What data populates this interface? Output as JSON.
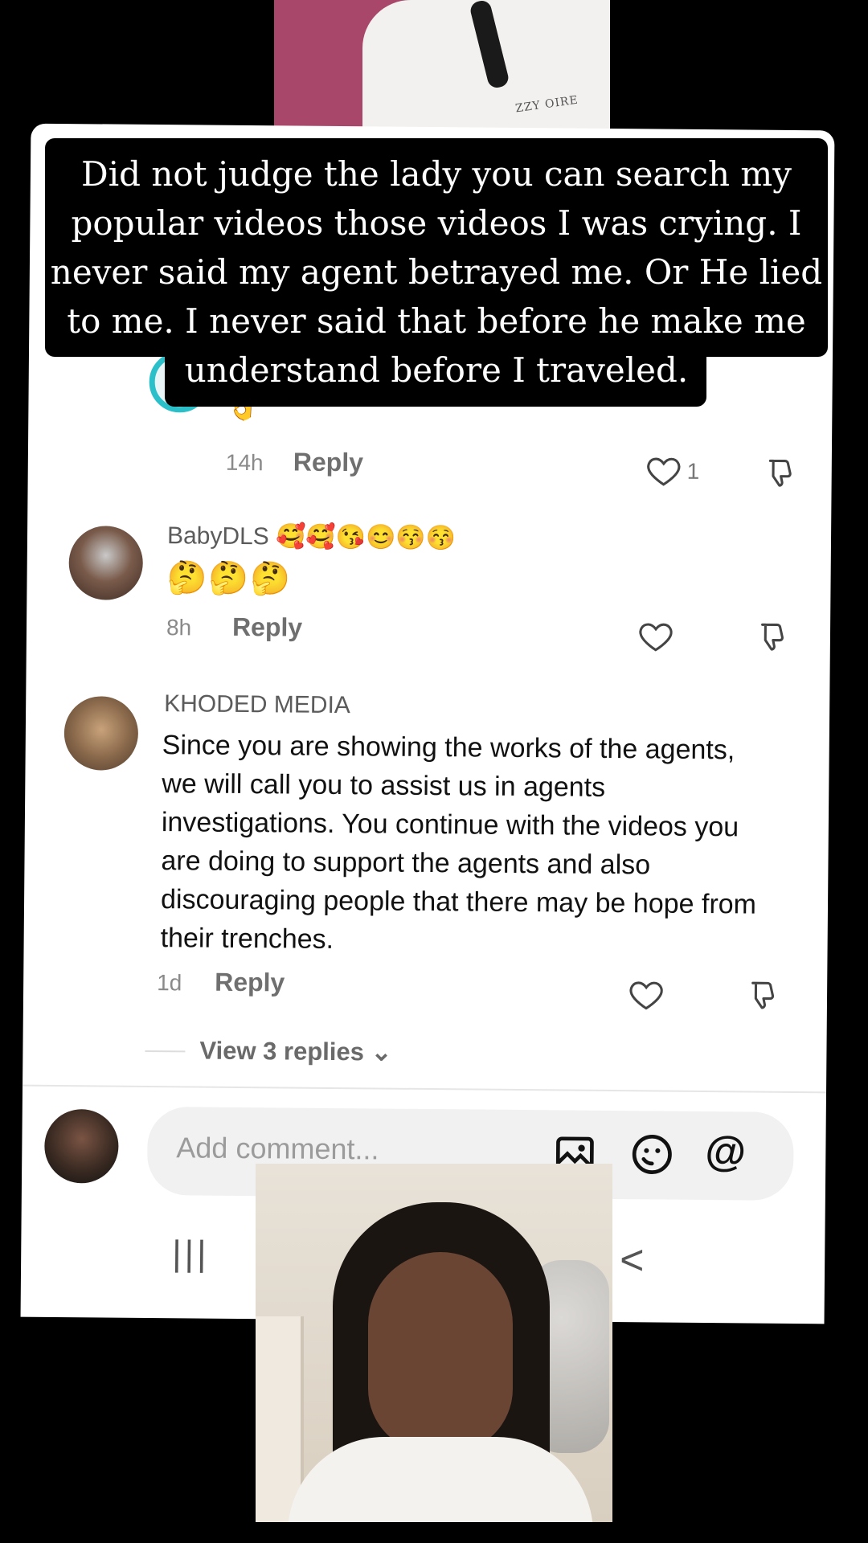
{
  "caption": {
    "text": "Did not judge the lady you can search my popular videos those videos I was crying. I never said my agent betrayed me. Or He lied to me. I never said that before he make me understand before I traveled."
  },
  "top_video": {
    "logo_text": "ZZY OIRE"
  },
  "comments": [
    {
      "name": "",
      "emojis": "👌",
      "time": "14h",
      "reply_label": "Reply",
      "like_count": "1"
    },
    {
      "name": "BabyDLS 🥰🥰😘😊😚😚",
      "emojis": "🤔🤔🤔",
      "time": "8h",
      "reply_label": "Reply",
      "like_count": ""
    },
    {
      "name": "KHODED MEDIA",
      "body": "Since you are showing the works of the agents, we will call you to assist us in agents investigations. You continue with the videos you are doing to support the agents and also discouraging people that there may be hope from their trenches.",
      "time": "1d",
      "reply_label": "Reply",
      "like_count": ""
    }
  ],
  "view_replies": "View 3 replies ⌄",
  "input": {
    "placeholder": "Add comment..."
  },
  "nav": {
    "recents": "|||",
    "back": "<"
  },
  "colors": {
    "background": "#000000",
    "panel": "#ffffff",
    "accent_ring": "#2bc0c9",
    "top_video_bg": "#a9476a"
  },
  "icons": {
    "heart": "heart-icon",
    "dislike": "dislike-icon",
    "image": "image-icon",
    "emoji": "emoji-icon",
    "at": "at-icon"
  }
}
